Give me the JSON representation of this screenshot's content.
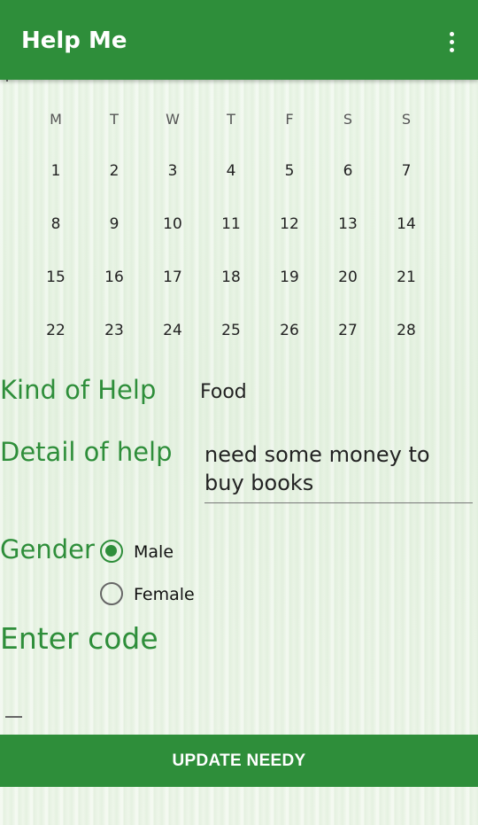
{
  "app": {
    "title": "Help Me"
  },
  "calendar": {
    "weekdays": [
      "M",
      "T",
      "W",
      "T",
      "F",
      "S",
      "S"
    ],
    "weeks": [
      [
        "1",
        "2",
        "3",
        "4",
        "5",
        "6",
        "7"
      ],
      [
        "8",
        "9",
        "10",
        "11",
        "12",
        "13",
        "14"
      ],
      [
        "15",
        "16",
        "17",
        "18",
        "19",
        "20",
        "21"
      ],
      [
        "22",
        "23",
        "24",
        "25",
        "26",
        "27",
        "28"
      ]
    ]
  },
  "form": {
    "kind_label": "Kind of Help",
    "kind_value": "Food",
    "detail_label": "Detail of help",
    "detail_value": "need some money to buy books",
    "gender_label": "Gender",
    "gender_options": [
      "Male",
      "Female"
    ],
    "gender_selected": "Male",
    "code_label": "Enter code",
    "code_value": ""
  },
  "actions": {
    "update_label": "UPDATE NEEDY"
  },
  "colors": {
    "primary": "#2e8e3a",
    "background": "#e8f3e4"
  },
  "icons": {
    "menu": "overflow-menu-icon"
  }
}
